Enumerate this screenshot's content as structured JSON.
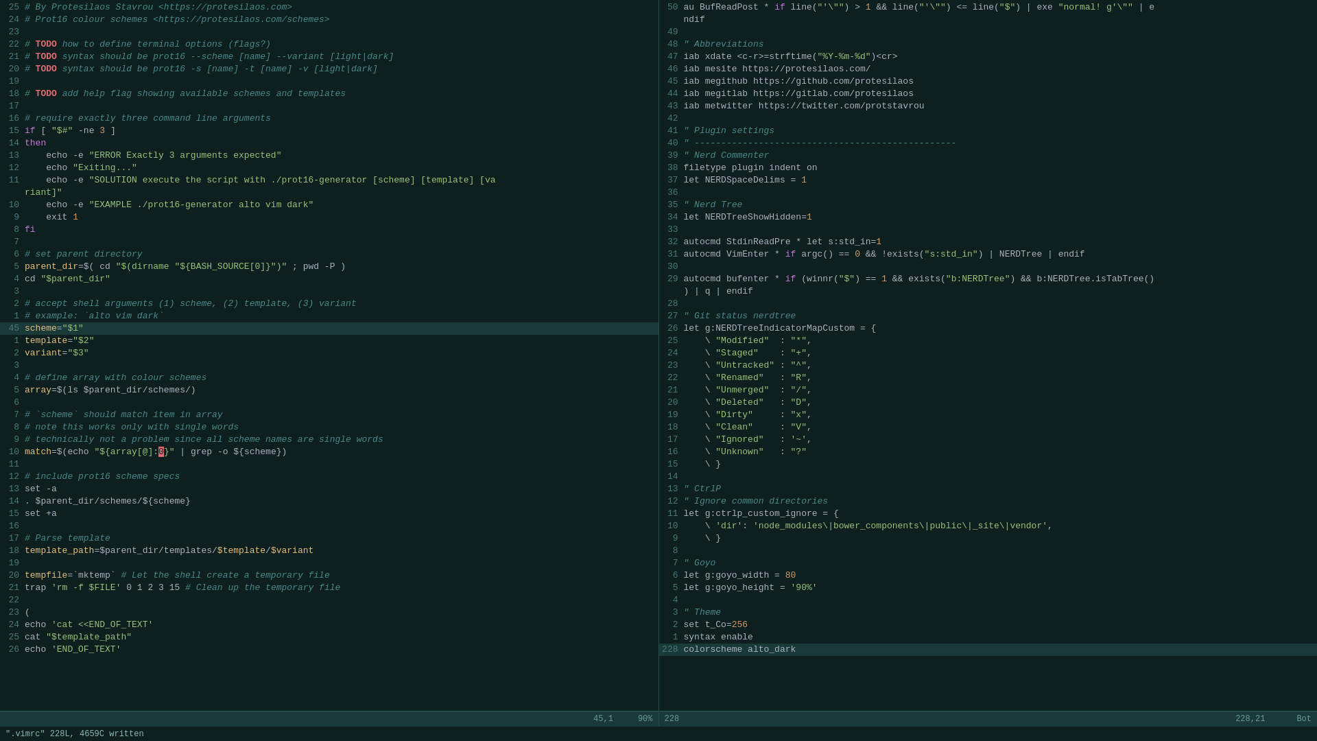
{
  "pane_left": {
    "lines": [
      {
        "num": "25",
        "content": "# By Protesilaos Stavrou <https://protesilaos.com>",
        "type": "comment"
      },
      {
        "num": "24",
        "content": "# Prot16 colour schemes <https://protesilaos.com/schemes>",
        "type": "comment"
      },
      {
        "num": "23",
        "content": "",
        "type": "blank"
      },
      {
        "num": "22",
        "content": "# TODO how to define terminal options (flags?)",
        "type": "todo"
      },
      {
        "num": "21",
        "content": "# TODO syntax should be prot16 --scheme [name] --variant [light|dark]",
        "type": "todo"
      },
      {
        "num": "20",
        "content": "# TODO syntax should be prot16 -s [name] -t [name] -v [light|dark]",
        "type": "todo"
      },
      {
        "num": "19",
        "content": "",
        "type": "blank"
      },
      {
        "num": "18",
        "content": "# TODO add help flag showing available schemes and templates",
        "type": "todo"
      },
      {
        "num": "17",
        "content": "",
        "type": "blank"
      },
      {
        "num": "16",
        "content": "# require exactly three command line arguments",
        "type": "comment"
      },
      {
        "num": "15",
        "content": "if [ \"$#\" -ne 3 ]",
        "type": "code"
      },
      {
        "num": "14",
        "content": "then",
        "type": "code"
      },
      {
        "num": "13",
        "content": "    echo -e \"ERROR Exactly 3 arguments expected\"",
        "type": "code"
      },
      {
        "num": "12",
        "content": "    echo \"Exiting...\"",
        "type": "code"
      },
      {
        "num": "11",
        "content": "    echo -e \"SOLUTION execute the script with ./prot16-generator [scheme] [template] [va",
        "type": "code"
      },
      {
        "num": "",
        "content": "riant]\"",
        "type": "wrapped"
      },
      {
        "num": "10",
        "content": "    echo -e \"EXAMPLE ./prot16-generator alto vim dark\"",
        "type": "code"
      },
      {
        "num": "9",
        "content": "    exit 1",
        "type": "code"
      },
      {
        "num": "8",
        "content": "fi",
        "type": "code"
      },
      {
        "num": "7",
        "content": "",
        "type": "blank"
      },
      {
        "num": "6",
        "content": "# set parent directory",
        "type": "comment"
      },
      {
        "num": "5",
        "content": "parent_dir=$( cd \"$(dirname \"${BASH_SOURCE[0]}\")\" ; pwd -P )",
        "type": "code"
      },
      {
        "num": "4",
        "content": "cd \"$parent_dir\"",
        "type": "code"
      },
      {
        "num": "3",
        "content": "",
        "type": "blank"
      },
      {
        "num": "2",
        "content": "# accept shell arguments (1) scheme, (2) template, (3) variant",
        "type": "comment"
      },
      {
        "num": "1",
        "content": "# example: `alto vim dark`",
        "type": "comment"
      },
      {
        "num": "45",
        "content": "scheme=\"$1\"",
        "type": "code",
        "highlighted": true
      },
      {
        "num": "1",
        "content": "template=\"$2\"",
        "type": "code"
      },
      {
        "num": "2",
        "content": "variant=\"$3\"",
        "type": "code"
      },
      {
        "num": "3",
        "content": "",
        "type": "blank"
      },
      {
        "num": "4",
        "content": "# define array with colour schemes",
        "type": "comment"
      },
      {
        "num": "5",
        "content": "array=$(ls $parent_dir/schemes/)",
        "type": "code"
      },
      {
        "num": "6",
        "content": "",
        "type": "blank"
      },
      {
        "num": "7",
        "content": "# scheme` should match item in array",
        "type": "comment"
      },
      {
        "num": "8",
        "content": "# note this works only with single words",
        "type": "comment"
      },
      {
        "num": "9",
        "content": "# technically not a problem since all scheme names are single words",
        "type": "comment"
      },
      {
        "num": "10",
        "content": "match=$(echo \"${array[@]:0}\" | grep -o ${scheme})",
        "type": "code"
      },
      {
        "num": "11",
        "content": "",
        "type": "blank"
      },
      {
        "num": "12",
        "content": "# include prot16 scheme specs",
        "type": "comment"
      },
      {
        "num": "13",
        "content": "set -a",
        "type": "code"
      },
      {
        "num": "14",
        "content": ". $parent_dir/schemes/${scheme}",
        "type": "code"
      },
      {
        "num": "15",
        "content": "set +a",
        "type": "code"
      },
      {
        "num": "16",
        "content": "",
        "type": "blank"
      },
      {
        "num": "17",
        "content": "# Parse template",
        "type": "comment"
      },
      {
        "num": "18",
        "content": "template_path=$parent_dir/templates/$template/$variant",
        "type": "code"
      },
      {
        "num": "19",
        "content": "",
        "type": "blank"
      },
      {
        "num": "20",
        "content": "tempfile=`mktemp` # Let the shell create a temporary file",
        "type": "code"
      },
      {
        "num": "21",
        "content": "trap 'rm -f $FILE' 0 1 2 3 15 # Clean up the temporary file",
        "type": "code"
      },
      {
        "num": "22",
        "content": "",
        "type": "blank"
      },
      {
        "num": "23",
        "content": "(",
        "type": "code"
      },
      {
        "num": "24",
        "content": "echo 'cat <<END_OF_TEXT'",
        "type": "code"
      },
      {
        "num": "25",
        "content": "cat \"$template_path\"",
        "type": "code"
      },
      {
        "num": "26",
        "content": "echo 'END_OF_TEXT'",
        "type": "code"
      }
    ],
    "status": "45,1",
    "percent": "90%"
  },
  "pane_right": {
    "lines": [
      {
        "num": "50",
        "content": "au BufReadPost * if line(\"'\\\"\") > 1 && line(\"'\\\"\") <= line(\"$\") | exe \"normal! g'\\\"\" | e"
      },
      {
        "num": "",
        "content": "ndif"
      },
      {
        "num": "49",
        "content": ""
      },
      {
        "num": "48",
        "content": "\" Abbreviations"
      },
      {
        "num": "47",
        "content": "iab xdate <c-r>=strftime(\"%Y-%m-%d\")<cr>"
      },
      {
        "num": "46",
        "content": "iab mesite https://protesilaos.com/"
      },
      {
        "num": "45",
        "content": "iab megithub https://github.com/protesilaos"
      },
      {
        "num": "44",
        "content": "iab megitlab https://gitlab.com/protesilaos"
      },
      {
        "num": "43",
        "content": "iab metwitter https://twitter.com/protstavrou"
      },
      {
        "num": "42",
        "content": ""
      },
      {
        "num": "41",
        "content": "\" Plugin settings"
      },
      {
        "num": "40",
        "content": "\" -------------------------------------------------"
      },
      {
        "num": "39",
        "content": "\" Nerd Commenter"
      },
      {
        "num": "38",
        "content": "filetype plugin indent on"
      },
      {
        "num": "37",
        "content": "let NERDSpaceDelims = 1"
      },
      {
        "num": "36",
        "content": ""
      },
      {
        "num": "35",
        "content": "\" Nerd Tree"
      },
      {
        "num": "34",
        "content": "let NERDTreeShowHidden=1"
      },
      {
        "num": "33",
        "content": ""
      },
      {
        "num": "32",
        "content": "autocmd StdinReadPre * let s:std_in=1"
      },
      {
        "num": "31",
        "content": "autocmd VimEnter * if argc() == 0 && !exists(\"s:std_in\") | NERDTree | endif"
      },
      {
        "num": "30",
        "content": ""
      },
      {
        "num": "29",
        "content": "autocmd bufenter * if (winnr(\"$\") == 1 && exists(\"b:NERDTree\") && b:NERDTree.isTabTree()"
      },
      {
        "num": "",
        "content": ") | q | endif"
      },
      {
        "num": "28",
        "content": ""
      },
      {
        "num": "27",
        "content": "\" Git status nerdtree"
      },
      {
        "num": "26",
        "content": "let g:NERDTreeIndicatorMapCustom = {"
      },
      {
        "num": "25",
        "content": "    \\ \"Modified\"  : \"*\","
      },
      {
        "num": "24",
        "content": "    \\ \"Staged\"    : \"+\","
      },
      {
        "num": "23",
        "content": "    \\ \"Untracked\" : \"^\","
      },
      {
        "num": "22",
        "content": "    \\ \"Renamed\"   : \"R\","
      },
      {
        "num": "21",
        "content": "    \\ \"Unmerged\"  : \"/\","
      },
      {
        "num": "20",
        "content": "    \\ \"Deleted\"   : \"D\","
      },
      {
        "num": "19",
        "content": "    \\ \"Dirty\"     : \"x\","
      },
      {
        "num": "18",
        "content": "    \\ \"Clean\"     : \"V\","
      },
      {
        "num": "17",
        "content": "    \\ \"Ignored\"   : '~',"
      },
      {
        "num": "16",
        "content": "    \\ \"Unknown\"   : \"?\""
      },
      {
        "num": "15",
        "content": "    \\ }"
      },
      {
        "num": "14",
        "content": ""
      },
      {
        "num": "13",
        "content": "\" CtrlP"
      },
      {
        "num": "12",
        "content": "\" Ignore common directories"
      },
      {
        "num": "11",
        "content": "let g:ctrlp_custom_ignore = {"
      },
      {
        "num": "10",
        "content": "    \\ 'dir': 'node_modules\\|bower_components\\|public\\|_site\\|vendor',"
      },
      {
        "num": "9",
        "content": "    \\ }"
      },
      {
        "num": "8",
        "content": ""
      },
      {
        "num": "7",
        "content": "\" Goyo"
      },
      {
        "num": "6",
        "content": "let g:goyo_width = 80"
      },
      {
        "num": "5",
        "content": "let g:goyo_height = '90%'"
      },
      {
        "num": "4",
        "content": ""
      },
      {
        "num": "3",
        "content": "\" Theme"
      },
      {
        "num": "2",
        "content": "set t_Co=256"
      },
      {
        "num": "1",
        "content": "syntax enable"
      },
      {
        "num": "228",
        "content": "colorscheme alto_dark",
        "highlighted": true
      }
    ],
    "status_line": "228",
    "status_col": "228,21",
    "status_bot": "Bot",
    "cmd_line": "\".vimrc\" 228L, 4659C written"
  }
}
